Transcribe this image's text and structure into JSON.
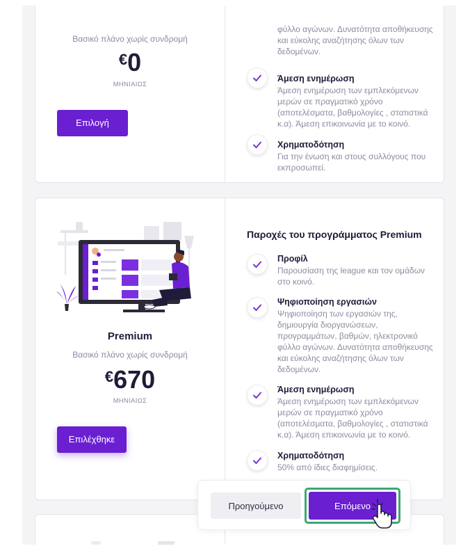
{
  "colors": {
    "accent": "#6a1fd1",
    "check": "#7a2fe0",
    "focus_outline": "#3aa873",
    "title_text": "#1e1c3a",
    "muted_text": "#8d8ba0"
  },
  "free_plan": {
    "subtitle": "Βασικό πλάνο χωρίς συνδρομή",
    "currency": "€",
    "price": "0",
    "period": "ΜΗΝΙΑΙΩΣ",
    "button_label": "Επιλογή",
    "features": [
      {
        "title": "",
        "desc": "φύλλο αγώνων. Δυνατότητα αποθήκευσης και εύκολης αναζήτησης όλων των δεδομένων."
      },
      {
        "title": "Άμεση ενημέρωση",
        "desc": "Άμεση ενημέρωση των εμπλεκόμενων μερών σε πραγματικό χρόνο (αποτελέσματα, βαθμολογίες , στατιστικά κ.α). Άμεση επικοινωνία με το κοινό."
      },
      {
        "title": "Χρηματοδότηση",
        "desc": "Για την ένωση και στους συλλόγους που εκπροσωπεί."
      }
    ]
  },
  "premium_plan": {
    "name": "Premium",
    "subtitle": "Βασικό πλάνο χωρίς συνδρομή",
    "currency": "€",
    "price": "670",
    "period": "ΜΗΝΙΑΙΩΣ",
    "button_label": "Επιλέχθηκε",
    "section_title": "Παροχές του προγράμματος Premium",
    "features": [
      {
        "title": "Προφίλ",
        "desc": "Παρουσίαση της league και τον ομάδων στο κοινό."
      },
      {
        "title": "Ψηφιοποίηση εργασιών",
        "desc": "Ψηφιοποίηση των εργασιών της, δημιουργία διοργανώσεων, προγραμμάτων, βαθμών, ηλεκτρονικό φύλλο αγώνων. Δυνατότητα αποθήκευσης και εύκολης αναζήτησης όλων των δεδομένων."
      },
      {
        "title": "Άμεση ενημέρωση",
        "desc": "Άμεση ενημέρωση των εμπλεκόμενων μερών σε πραγματικό χρόνο (αποτελέσματα, βαθμολογίες , στατιστικά κ.α). Άμεση επικοινωνία με το κοινό."
      },
      {
        "title": "Χρηματοδότηση",
        "desc": "50% από ίδιες διαφημίσεις."
      }
    ]
  },
  "navigation": {
    "prev_label": "Προηγούμενο",
    "next_label": "Επόμενο"
  }
}
